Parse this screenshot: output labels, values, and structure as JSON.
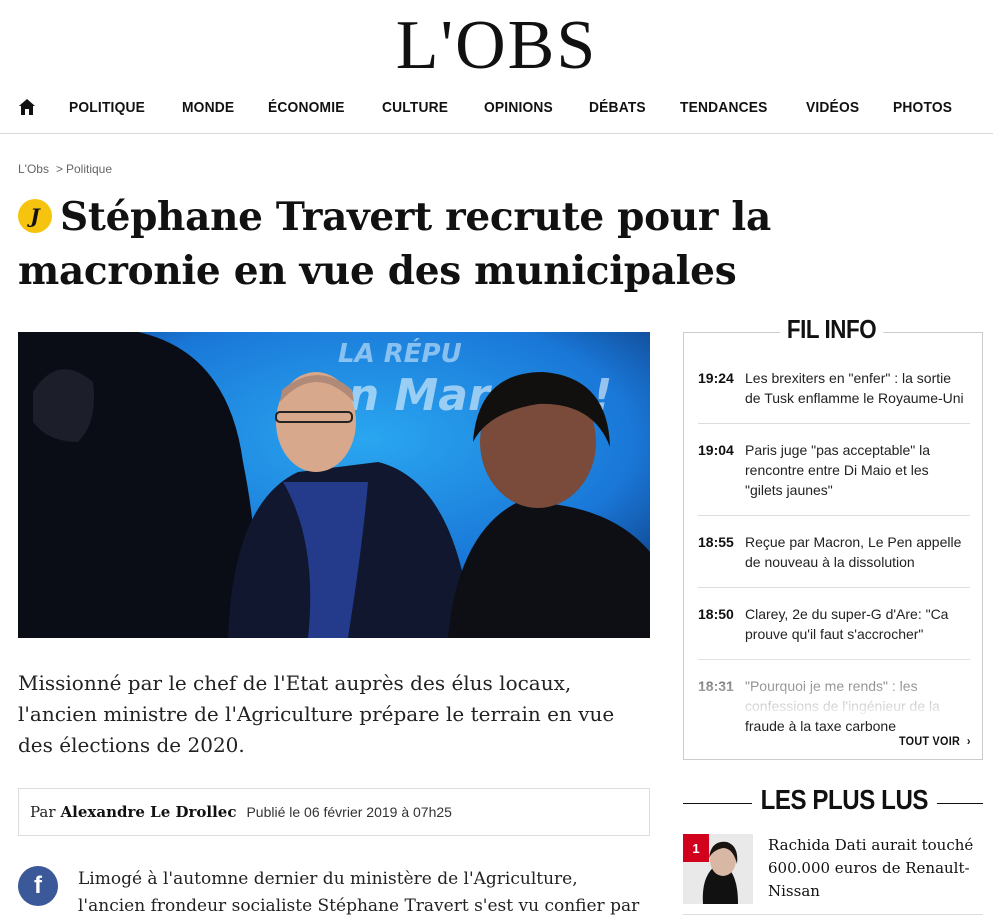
{
  "site": {
    "logo": "L'OBS"
  },
  "nav": {
    "home_icon": "home-icon",
    "items": [
      "POLITIQUE",
      "MONDE",
      "ÉCONOMIE",
      "CULTURE",
      "OPINIONS",
      "DÉBATS",
      "TENDANCES",
      "VIDÉOS",
      "PHOTOS"
    ]
  },
  "breadcrumb": {
    "root": "L'Obs",
    "separator": ">",
    "section": "Politique"
  },
  "article": {
    "badge": "J",
    "title": "Stéphane Travert recrute pour la macronie en vue des municipales",
    "image_banner_text": "La Répu... en Marche !",
    "lede": "Missionné par le chef de l'Etat auprès des élus locaux, l'ancien ministre de l'Agriculture prépare le terrain en vue des élections de 2020.",
    "byline_prefix": "Par",
    "author": "Alexandre Le Drollec",
    "published": "Publié le 06 février 2019 à 07h25",
    "body_start": "Limogé à l'automne dernier du ministère de l'Agriculture, l'ancien frondeur socialiste Stéphane Travert s'est vu confier par Emmanuel"
  },
  "fil_info": {
    "title": "FIL INFO",
    "items": [
      {
        "time": "19:24",
        "headline": "Les brexiters en \"enfer\" : la sortie de Tusk enflamme le Royaume-Uni"
      },
      {
        "time": "19:04",
        "headline": "Paris juge \"pas acceptable\" la rencontre entre Di Maio et les \"gilets jaunes\""
      },
      {
        "time": "18:55",
        "headline": "Reçue par Macron, Le Pen appelle de nouveau à la dissolution"
      },
      {
        "time": "18:50",
        "headline": "Clarey, 2e du super-G d'Are: \"Ca prouve qu'il faut s'accrocher\""
      },
      {
        "time": "18:31",
        "headline": "\"Pourquoi je me rends\" : les confessions de l'ingénieur de la fraude à la taxe carbone"
      }
    ],
    "see_all": "TOUT VOIR"
  },
  "plus_lus": {
    "title": "LES PLUS LUS",
    "items": [
      {
        "rank": "1",
        "headline": "Rachida Dati aurait touché 600.000 euros de Renault-Nissan"
      }
    ]
  },
  "social": {
    "facebook_icon": "facebook-icon"
  },
  "colors": {
    "badge": "#f6c40f",
    "rank_badge": "#d1001c",
    "facebook": "#3b5998"
  }
}
